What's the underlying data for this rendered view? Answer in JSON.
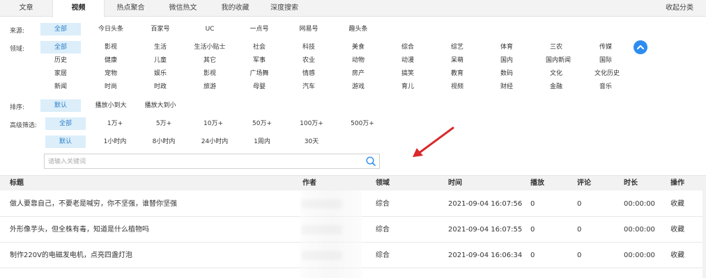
{
  "tabs": [
    {
      "label": "文章",
      "active": false
    },
    {
      "label": "视频",
      "active": true
    },
    {
      "label": "热点聚合",
      "active": false
    },
    {
      "label": "微信热文",
      "active": false
    },
    {
      "label": "我的收藏",
      "active": false
    },
    {
      "label": "深度搜索",
      "active": false
    }
  ],
  "collapse_label": "收起分类",
  "filters": {
    "source": {
      "label": "来源:",
      "selected": "全部",
      "options": [
        "全部",
        "今日头条",
        "百家号",
        "UC",
        "一点号",
        "网易号",
        "趣头条"
      ]
    },
    "domain": {
      "label": "领域:",
      "selected": "全部",
      "rows": [
        [
          "全部",
          "影视",
          "生活",
          "生活小贴士",
          "社会",
          "科技",
          "美食",
          "综合",
          "综艺",
          "体育",
          "三农",
          "传媒"
        ],
        [
          "历史",
          "健康",
          "儿童",
          "其它",
          "军事",
          "农业",
          "动物",
          "动漫",
          "呆萌",
          "国内",
          "国内新闻",
          "国际"
        ],
        [
          "家居",
          "宠物",
          "娱乐",
          "影视",
          "广场舞",
          "情感",
          "房产",
          "搞笑",
          "教育",
          "数码",
          "文化",
          "文化历史"
        ],
        [
          "新闻",
          "时尚",
          "时政",
          "旅游",
          "母婴",
          "汽车",
          "游戏",
          "育儿",
          "视频",
          "财经",
          "金融",
          "音乐"
        ]
      ]
    },
    "sort": {
      "label": "排序:",
      "selected": "默认",
      "options": [
        "默认",
        "播放小到大",
        "播放大到小"
      ]
    },
    "advanced": {
      "label": "高级筛选:",
      "plays": {
        "selected": "全部",
        "options": [
          "全部",
          "1万+",
          "5万+",
          "10万+",
          "50万+",
          "100万+",
          "500万+"
        ]
      },
      "time": {
        "selected": "默认",
        "options": [
          "默认",
          "1小时内",
          "8小时内",
          "24小时内",
          "1周内",
          "30天"
        ]
      }
    }
  },
  "search": {
    "placeholder": "请输入关键词",
    "value": ""
  },
  "table": {
    "headers": [
      "标题",
      "作者",
      "领域",
      "时间",
      "播放",
      "评论",
      "时长",
      "操作"
    ],
    "rows": [
      {
        "title": "做人要靠自己，不要老是喊穷，你不坚强，谁替你坚强",
        "author": "",
        "domain": "综合",
        "time": "2021-09-04 16:07:56",
        "plays": "0",
        "comments": "0",
        "duration": "00:00:00",
        "action": "收藏"
      },
      {
        "title": "外形像芋头，但全株有毒，知道是什么植物吗",
        "author": "",
        "domain": "综合",
        "time": "2021-09-04 16:07:55",
        "plays": "0",
        "comments": "0",
        "duration": "00:00:00",
        "action": "收藏"
      },
      {
        "title": "制作220V的电磁发电机，点亮四盏灯泡",
        "author": "",
        "domain": "综合",
        "time": "2021-09-04 16:06:34",
        "plays": "0",
        "comments": "0",
        "duration": "00:00:00",
        "action": "收藏"
      }
    ]
  },
  "colors": {
    "accent": "#2d8cf0",
    "selected_bg": "#dbeefa",
    "annotation_arrow": "#d9292b"
  },
  "icons": {
    "expand": "chevron-up-icon",
    "search": "search-icon",
    "annotation": "red-arrow-icon"
  }
}
